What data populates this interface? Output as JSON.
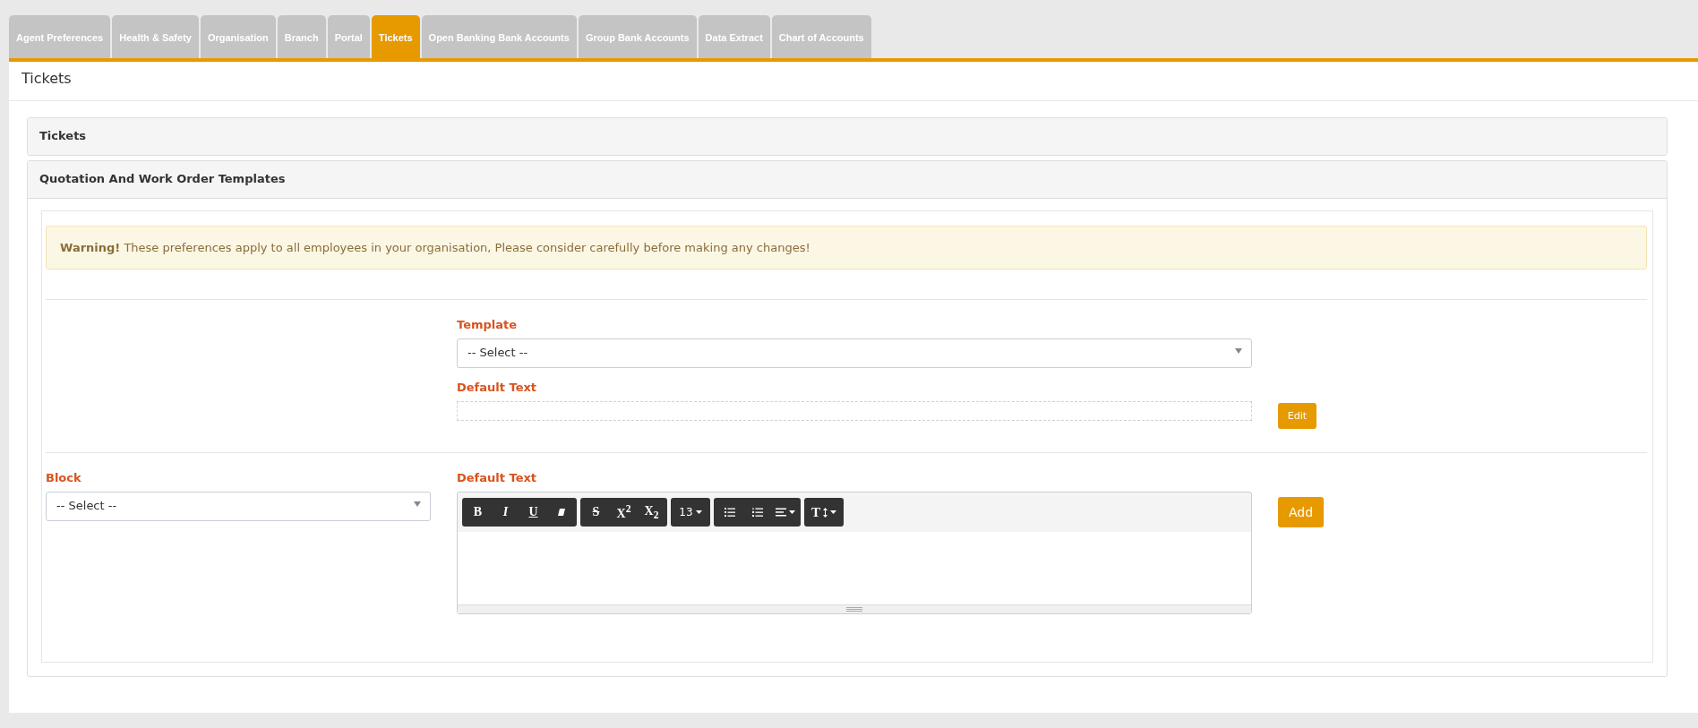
{
  "tabs": [
    {
      "label": "Agent Preferences",
      "selected": false
    },
    {
      "label": "Health & Safety",
      "selected": false
    },
    {
      "label": "Organisation",
      "selected": false
    },
    {
      "label": "Branch",
      "selected": false
    },
    {
      "label": "Portal",
      "selected": false
    },
    {
      "label": "Tickets",
      "selected": true
    },
    {
      "label": "Open Banking Bank Accounts",
      "selected": false
    },
    {
      "label": "Group Bank Accounts",
      "selected": false
    },
    {
      "label": "Data Extract",
      "selected": false
    },
    {
      "label": "Chart of Accounts",
      "selected": false
    }
  ],
  "page_title": "Tickets",
  "panels": [
    {
      "title": "Tickets",
      "expanded": false
    },
    {
      "title": "Quotation And Work Order Templates",
      "expanded": true
    }
  ],
  "warning": "**Warning!** These preferences apply to all employees in your organisation, Please consider carefully before making any changes!",
  "template": {
    "label": "Template",
    "value": "-- Select --"
  },
  "default_text": {
    "label": "Default Text"
  },
  "edit_button": "Edit",
  "block": {
    "label": "Block",
    "value": "-- Select --"
  },
  "editor": {
    "label": "Default Text",
    "toolbar": [
      [
        {
          "kind": "bold",
          "label": "B"
        },
        {
          "kind": "italic",
          "label": "I"
        },
        {
          "kind": "underline",
          "label": "U"
        },
        {
          "kind": "eraser"
        }
      ],
      [
        {
          "kind": "strike",
          "label": "S"
        },
        {
          "kind": "sup",
          "label": "X$^{2}$"
        },
        {
          "kind": "sub",
          "label": "X$_{2}$"
        }
      ],
      [
        {
          "kind": "fontsize",
          "label": "13"
        }
      ],
      [
        {
          "kind": "ul"
        },
        {
          "kind": "ol"
        },
        {
          "kind": "align"
        }
      ],
      [
        {
          "kind": "height",
          "label": "T"
        }
      ]
    ]
  },
  "add_button": "Add"
}
